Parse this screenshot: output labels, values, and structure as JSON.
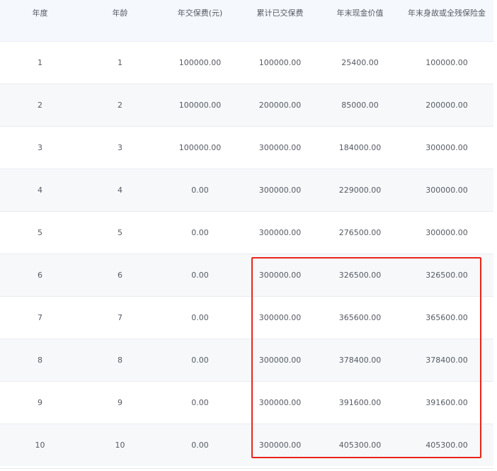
{
  "table": {
    "headers": [
      "年度",
      "年龄",
      "年交保费(元)",
      "累计已交保费",
      "年末现金价值",
      "年末身故或全残保险金"
    ],
    "rows": [
      [
        "1",
        "1",
        "100000.00",
        "100000.00",
        "25400.00",
        "100000.00"
      ],
      [
        "2",
        "2",
        "100000.00",
        "200000.00",
        "85000.00",
        "200000.00"
      ],
      [
        "3",
        "3",
        "100000.00",
        "300000.00",
        "184000.00",
        "300000.00"
      ],
      [
        "4",
        "4",
        "0.00",
        "300000.00",
        "229000.00",
        "300000.00"
      ],
      [
        "5",
        "5",
        "0.00",
        "300000.00",
        "276500.00",
        "300000.00"
      ],
      [
        "6",
        "6",
        "0.00",
        "300000.00",
        "326500.00",
        "326500.00"
      ],
      [
        "7",
        "7",
        "0.00",
        "300000.00",
        "365600.00",
        "365600.00"
      ],
      [
        "8",
        "8",
        "0.00",
        "300000.00",
        "378400.00",
        "378400.00"
      ],
      [
        "9",
        "9",
        "0.00",
        "300000.00",
        "391600.00",
        "391600.00"
      ],
      [
        "10",
        "10",
        "0.00",
        "300000.00",
        "405300.00",
        "405300.00"
      ]
    ]
  },
  "colors": {
    "header_bg": "#f5f8fd",
    "row_alt_bg": "#f7f8fa",
    "text": "#555a63",
    "highlight_border": "#e8251c"
  }
}
